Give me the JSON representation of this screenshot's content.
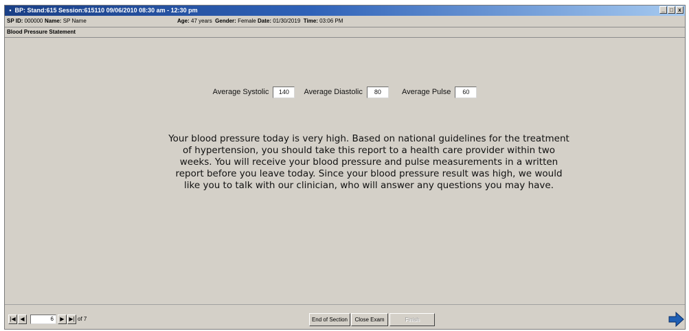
{
  "window": {
    "title_icon": "app-icon",
    "title": "BP: Stand:615 Session:615110 09/06/2010 08:30 am - 12:30 pm",
    "buttons": {
      "minimize": "_",
      "maximize": "□",
      "close": "x"
    }
  },
  "info": {
    "sp_id_label": "SP ID:",
    "sp_id": "000000",
    "name_label": "Name:",
    "name": "SP Name",
    "age_label": "Age:",
    "age": "47 years",
    "gender_label": "Gender:",
    "gender": "Female",
    "date_label": "Date:",
    "date": "01/30/2019",
    "time_label": "Time:",
    "time": "03:06 PM"
  },
  "section": {
    "title": "Blood Pressure Statement"
  },
  "measures": {
    "systolic_label": "Average Systolic",
    "systolic": "140",
    "diastolic_label": "Average Diastolic",
    "diastolic": "80",
    "pulse_label": "Average Pulse",
    "pulse": "60"
  },
  "statement": [
    "Your blood pressure today is very high.  Based on national guidelines for the treatment",
    "of hypertension, you should take this report to a health care provider within two",
    "weeks.  You will receive your blood pressure and pulse measurements in a written",
    "report before you leave today.  Since your blood pressure result was high, we would",
    "like you to talk with our clinician, who will answer any questions you may have."
  ],
  "nav": {
    "record": "6",
    "of_label": "of 7",
    "end_section": "End of Section",
    "close_exam": "Close Exam",
    "finish": "Finish",
    "next_icon": "arrow-right-icon"
  },
  "colors": {
    "titlebar": "#1a3f86",
    "panel": "#d4d0c8",
    "accent_arrow": "#1f5fb4"
  }
}
